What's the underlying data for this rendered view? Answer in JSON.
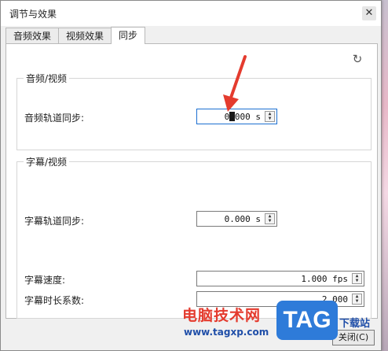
{
  "window": {
    "title": "调节与效果",
    "close_glyph": "✕"
  },
  "tabs": [
    {
      "label": "音频效果",
      "active": false
    },
    {
      "label": "视频效果",
      "active": false
    },
    {
      "label": "同步",
      "active": true
    }
  ],
  "refresh_icon": "refresh-icon",
  "audio_video": {
    "title": "音频/视频",
    "track_sync_label": "音频轨道同步:",
    "track_sync_value": "0.000 s"
  },
  "subtitle_video": {
    "title": "字幕/视频",
    "track_sync_label": "字幕轨道同步:",
    "track_sync_value": "0.000 s",
    "speed_label": "字幕速度:",
    "speed_value": "1.000 fps",
    "duration_label": "字幕时长系数:",
    "duration_value": "2.000"
  },
  "close_button_label": "关闭(C)",
  "watermark": {
    "text": "电脑技术网",
    "url": "www.tagxp.com",
    "logo": "TAG",
    "extra": "下载站"
  },
  "colors": {
    "accent": "#1c6fd1",
    "arrow": "#e43b2e"
  }
}
